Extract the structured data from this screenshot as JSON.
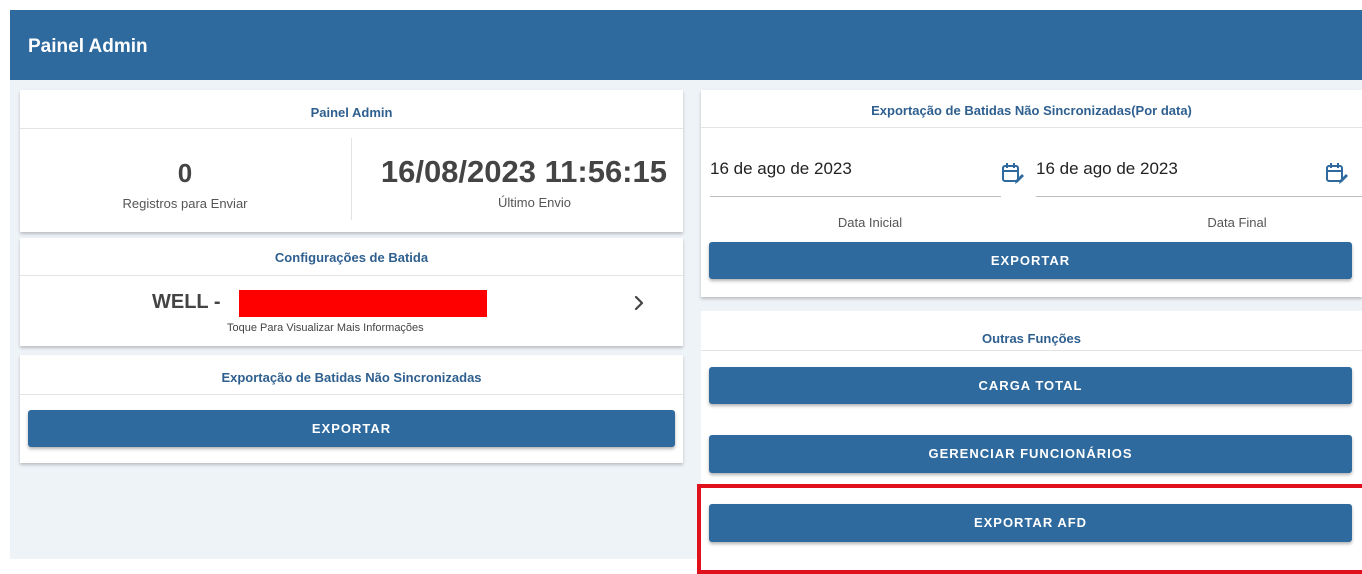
{
  "topbar": {
    "title": "Painel Admin"
  },
  "admin_card": {
    "title": "Painel Admin",
    "records_count": "0",
    "records_label": "Registros para Enviar",
    "last_send_datetime": "16/08/2023 11:56:15",
    "last_send_label": "Último Envio"
  },
  "config_card": {
    "title": "Configurações de Batida",
    "device_name": "WELL -",
    "hint": "Toque Para Visualizar Mais Informações"
  },
  "export_unsync_card": {
    "title": "Exportação de Batidas Não Sincronizadas",
    "button": "EXPORTAR"
  },
  "export_by_date_card": {
    "title": "Exportação de Batidas Não Sincronizadas(Por data)",
    "start_date": "16 de ago de 2023",
    "start_label": "Data Inicial",
    "end_date": "16 de ago de 2023",
    "end_label": "Data Final",
    "button": "EXPORTAR"
  },
  "other_functions_card": {
    "title": "Outras Funções",
    "buttons": [
      "CARGA TOTAL",
      "GERENCIAR FUNCIONÁRIOS",
      "EXPORTAR AFD"
    ]
  },
  "colors": {
    "primary": "#2e6a9e",
    "title_text": "#2e5f8f",
    "redaction": "#ff0000",
    "highlight_border": "#e0101d",
    "background": "#eef3f8"
  },
  "icons": [
    "calendar-edit-icon",
    "chevron-right-icon"
  ]
}
